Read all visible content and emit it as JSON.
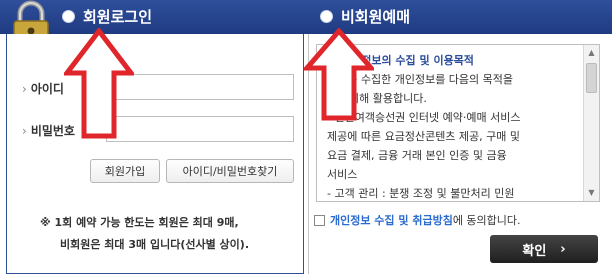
{
  "tabs": {
    "member_login": "회원로그인",
    "non_member": "비회원예매"
  },
  "login": {
    "id_label": "아이디",
    "password_label": "비밀번호",
    "id_value": "",
    "password_value": "",
    "join_button": "회원가입",
    "find_button": "아이디/비밀번호찾기"
  },
  "notice": {
    "line1": "※ 1회 예약 가능 한도는 회원은 최대 9매,",
    "line2": "비회원은 최대 3매 입니다(선사별 상이)."
  },
  "terms": {
    "title": "개인정보의 수집 및 이용목적",
    "lines": [
      "회사는 수집한 개인정보를 다음의 목적을",
      "위해 활용합니다.",
      "- 연안여객승선권 인터넷 예약·예매 서비스",
      "제공에 따른 요금정산콘텐츠 제공, 구매 및",
      "요금 결제, 금융 거래 본인 인증 및 금융",
      "서비스",
      "- 고객 관리 : 분쟁 조정 및 불만처리 민원"
    ]
  },
  "agree": {
    "link_text": "개인정보 수집 및 취급방침",
    "suffix": "에 동의합니다."
  },
  "confirm_button": "확인",
  "colors": {
    "header": "#2f4f9b",
    "arrow": "#e0262b",
    "link": "#2a6bd1"
  }
}
